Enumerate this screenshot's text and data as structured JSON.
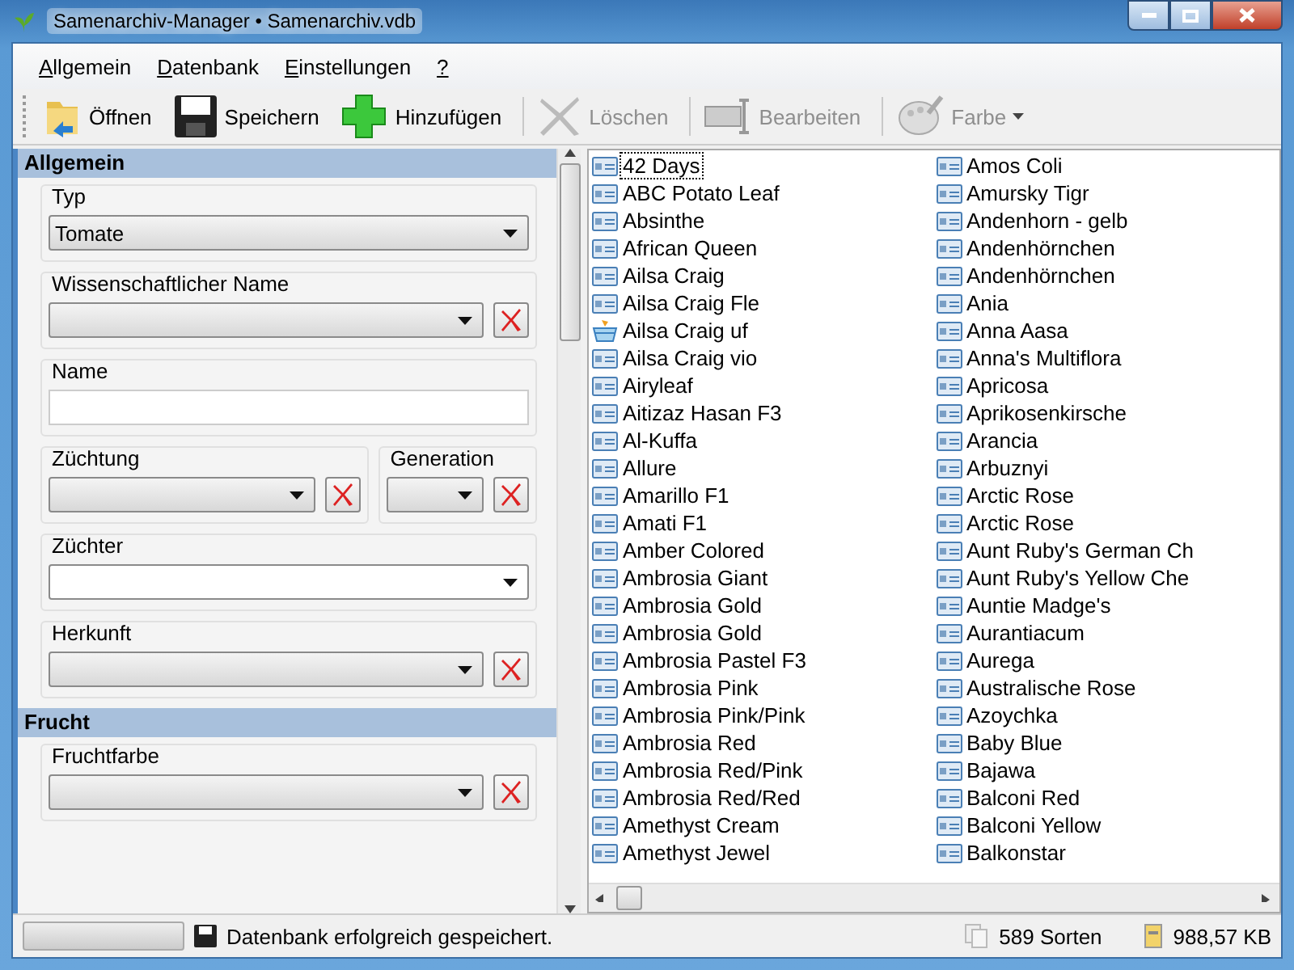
{
  "window": {
    "title": "Samenarchiv-Manager • Samenarchiv.vdb"
  },
  "menu": [
    {
      "label": "Allgemein"
    },
    {
      "label": "Datenbank"
    },
    {
      "label": "Einstellungen"
    },
    {
      "label": "?"
    }
  ],
  "toolbar": [
    {
      "label": "Öffnen",
      "kind": "folder",
      "disabled": false,
      "dropdown": false
    },
    {
      "label": "Speichern",
      "kind": "disk",
      "disabled": false,
      "dropdown": false
    },
    {
      "label": "Hinzufügen",
      "kind": "plus",
      "disabled": false,
      "dropdown": false
    },
    {
      "label": "Löschen",
      "kind": "cross",
      "disabled": true,
      "dropdown": false
    },
    {
      "label": "Bearbeiten",
      "kind": "edit",
      "disabled": true,
      "dropdown": false
    },
    {
      "label": "Farbe",
      "kind": "palette",
      "disabled": true,
      "dropdown": true
    }
  ],
  "sections": [
    {
      "title": "Allgemein",
      "rows": [
        [
          {
            "label": "Typ",
            "kind": "combo",
            "value": "Tomate",
            "clear": false
          }
        ],
        [
          {
            "label": "Wissenschaftlicher Name",
            "kind": "combo",
            "clear": true
          }
        ],
        [
          {
            "label": "Name",
            "kind": "text",
            "clear": false
          }
        ],
        [
          {
            "label": "Züchtung",
            "kind": "combo",
            "clear": true
          },
          {
            "label": "Generation",
            "kind": "combo",
            "clear": true
          }
        ],
        [
          {
            "label": "Züchter",
            "kind": "editcombo",
            "clear": false
          }
        ],
        [
          {
            "label": "Herkunft",
            "kind": "combo",
            "clear": true
          }
        ]
      ]
    },
    {
      "title": "Frucht",
      "rows": [
        [
          {
            "label": "Fruchtfarbe",
            "kind": "combo",
            "clear": true
          }
        ]
      ]
    }
  ],
  "list": {
    "columns": [
      [
        {
          "name": "42 Days",
          "kind": "card",
          "selected": true
        },
        {
          "name": "ABC Potato Leaf",
          "kind": "card",
          "selected": false
        },
        {
          "name": "Absinthe",
          "kind": "card",
          "selected": false
        },
        {
          "name": "African Queen",
          "kind": "card",
          "selected": false
        },
        {
          "name": "Ailsa Craig",
          "kind": "card",
          "selected": false
        },
        {
          "name": "Ailsa Craig Fle",
          "kind": "card",
          "selected": false
        },
        {
          "name": "Ailsa Craig uf",
          "kind": "basket",
          "selected": false
        },
        {
          "name": "Ailsa Craig vio",
          "kind": "card",
          "selected": false
        },
        {
          "name": "Airyleaf",
          "kind": "card",
          "selected": false
        },
        {
          "name": "Aitizaz Hasan F3",
          "kind": "card",
          "selected": false
        },
        {
          "name": "Al-Kuffa",
          "kind": "card",
          "selected": false
        },
        {
          "name": "Allure",
          "kind": "card",
          "selected": false
        },
        {
          "name": "Amarillo F1",
          "kind": "card",
          "selected": false
        },
        {
          "name": "Amati F1",
          "kind": "card",
          "selected": false
        },
        {
          "name": "Amber Colored",
          "kind": "card",
          "selected": false
        },
        {
          "name": "Ambrosia Giant",
          "kind": "card",
          "selected": false
        },
        {
          "name": "Ambrosia Gold",
          "kind": "card",
          "selected": false
        },
        {
          "name": "Ambrosia Gold",
          "kind": "card",
          "selected": false
        },
        {
          "name": "Ambrosia Pastel F3",
          "kind": "card",
          "selected": false
        },
        {
          "name": "Ambrosia Pink",
          "kind": "card",
          "selected": false
        },
        {
          "name": "Ambrosia Pink/Pink",
          "kind": "card",
          "selected": false
        },
        {
          "name": "Ambrosia Red",
          "kind": "card",
          "selected": false
        },
        {
          "name": "Ambrosia Red/Pink",
          "kind": "card",
          "selected": false
        },
        {
          "name": "Ambrosia Red/Red",
          "kind": "card",
          "selected": false
        },
        {
          "name": "Amethyst Cream",
          "kind": "card",
          "selected": false
        },
        {
          "name": "Amethyst Jewel",
          "kind": "card",
          "selected": false
        }
      ],
      [
        {
          "name": "Amos Coli",
          "kind": "card",
          "selected": false
        },
        {
          "name": "Amursky Tigr",
          "kind": "card",
          "selected": false
        },
        {
          "name": "Andenhorn - gelb",
          "kind": "card",
          "selected": false
        },
        {
          "name": "Andenhörnchen",
          "kind": "card",
          "selected": false
        },
        {
          "name": "Andenhörnchen",
          "kind": "card",
          "selected": false
        },
        {
          "name": "Ania",
          "kind": "card",
          "selected": false
        },
        {
          "name": "Anna Aasa",
          "kind": "card",
          "selected": false
        },
        {
          "name": "Anna's Multiflora",
          "kind": "card",
          "selected": false
        },
        {
          "name": "Apricosa",
          "kind": "card",
          "selected": false
        },
        {
          "name": "Aprikosenkirsche",
          "kind": "card",
          "selected": false
        },
        {
          "name": "Arancia",
          "kind": "card",
          "selected": false
        },
        {
          "name": "Arbuznyi",
          "kind": "card",
          "selected": false
        },
        {
          "name": "Arctic Rose",
          "kind": "card",
          "selected": false
        },
        {
          "name": "Arctic Rose",
          "kind": "card",
          "selected": false
        },
        {
          "name": "Aunt Ruby's German Ch",
          "kind": "card",
          "selected": false
        },
        {
          "name": "Aunt Ruby's Yellow Che",
          "kind": "card",
          "selected": false
        },
        {
          "name": "Auntie Madge's",
          "kind": "card",
          "selected": false
        },
        {
          "name": "Aurantiacum",
          "kind": "card",
          "selected": false
        },
        {
          "name": "Aurega",
          "kind": "card",
          "selected": false
        },
        {
          "name": "Australische Rose",
          "kind": "card",
          "selected": false
        },
        {
          "name": "Azoychka",
          "kind": "card",
          "selected": false
        },
        {
          "name": "Baby Blue",
          "kind": "card",
          "selected": false
        },
        {
          "name": "Bajawa",
          "kind": "card",
          "selected": false
        },
        {
          "name": "Balconi Red",
          "kind": "card",
          "selected": false
        },
        {
          "name": "Balconi Yellow",
          "kind": "card",
          "selected": false
        },
        {
          "name": "Balkonstar",
          "kind": "card",
          "selected": false
        }
      ]
    ]
  },
  "status_bar": {
    "progress": {
      "level": 0
    },
    "message": "Datenbank erfolgreich gespeichert.",
    "count": "589 Sorten",
    "size": "988,57 KB"
  }
}
